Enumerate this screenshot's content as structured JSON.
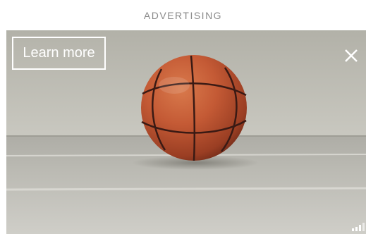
{
  "ad": {
    "label": "ADVERTISING",
    "cta_label": "Learn more",
    "image_subject": "basketball",
    "icons": {
      "close": "close-icon",
      "signal": "signal-bars-icon"
    },
    "colors": {
      "label_text": "#8a8a8a",
      "cta_border": "#ffffff",
      "cta_text": "#ffffff"
    }
  }
}
